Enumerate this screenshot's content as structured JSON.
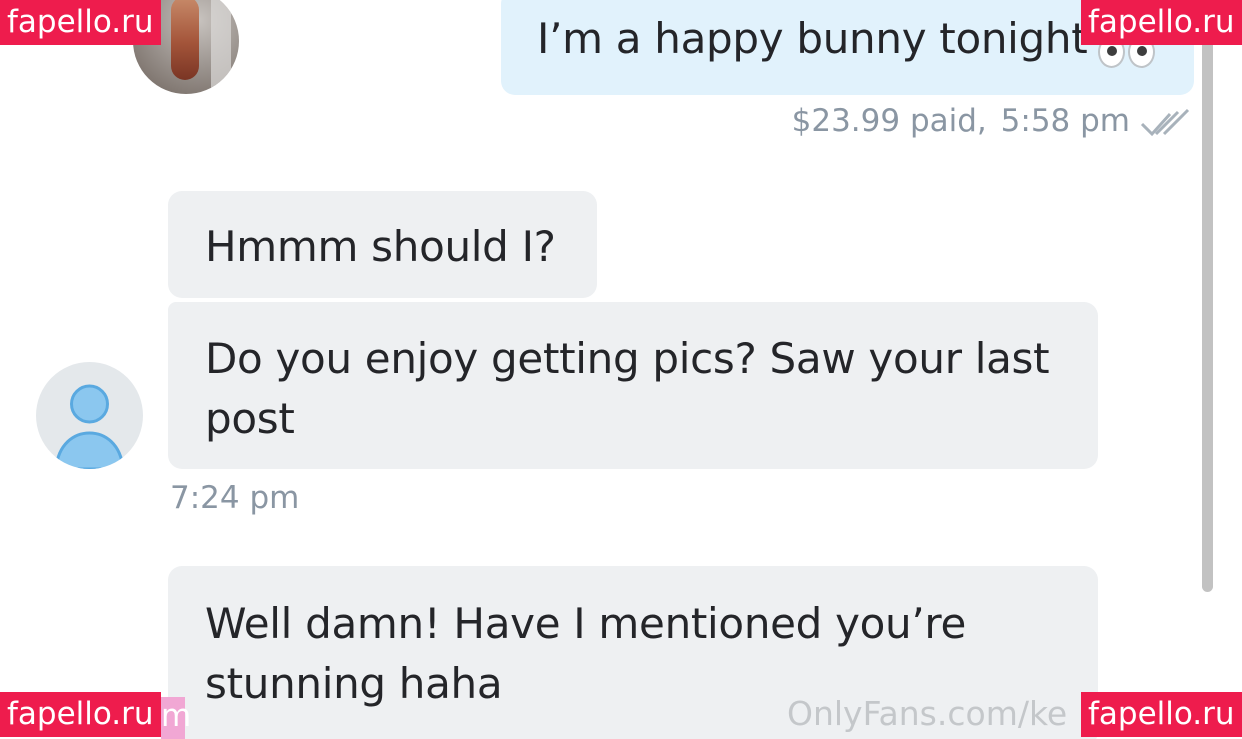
{
  "thread": {
    "outgoing": {
      "text": "I’m a happy bunny tonight",
      "emoji_icon": "eyes-icon",
      "price": "$23.99 paid,",
      "time": "5:58 pm",
      "status_icon": "double-check-icon"
    },
    "incoming": [
      {
        "text": "Hmmm should I?"
      },
      {
        "text": "Do you enjoy getting pics? Saw your last post"
      },
      {
        "text": "Well damn! Have I mentioned you’re stunning haha"
      }
    ],
    "incoming_time": "7:24 pm"
  },
  "watermarks": {
    "fapello": "fapello.ru",
    "fragment": "m",
    "onlyfans": "OnlyFans.com/ke"
  },
  "colors": {
    "outgoing_bubble": "#e1f2fc",
    "incoming_bubble": "#eef0f2",
    "meta_text": "#8a96a3",
    "avatar_blue": "#8bc7ef",
    "watermark_red": "#ee1c4d"
  }
}
